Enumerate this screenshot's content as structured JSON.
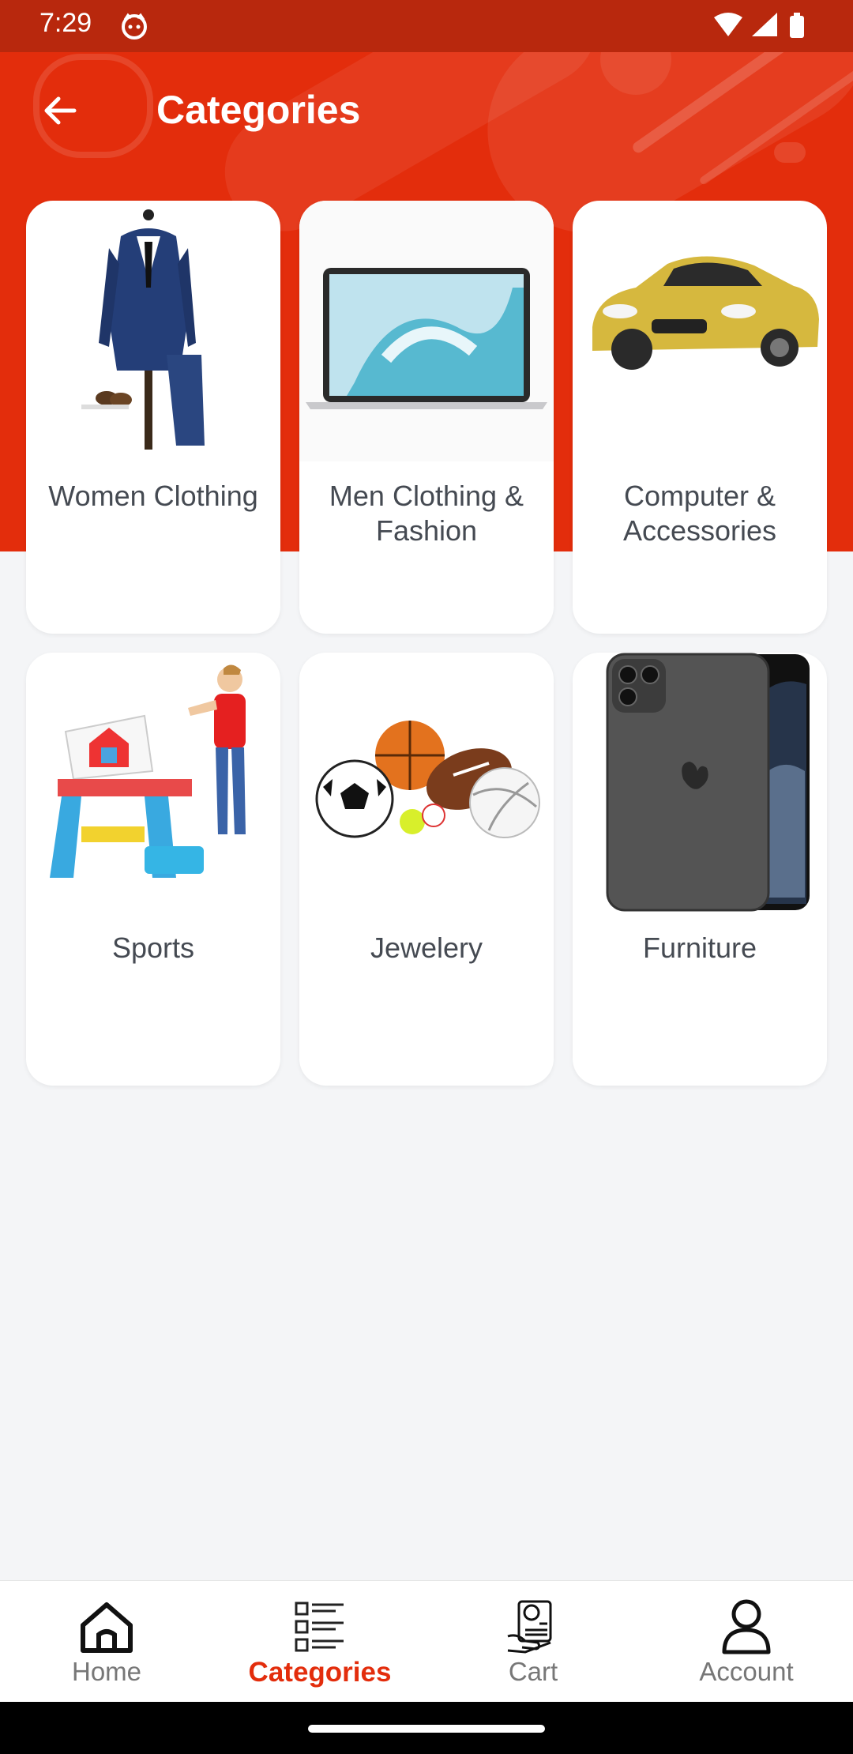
{
  "status_bar": {
    "time": "7:29"
  },
  "header": {
    "title": "Categories"
  },
  "categories": [
    {
      "label": "Women Clothing"
    },
    {
      "label": "Men Clothing & Fashion"
    },
    {
      "label": "Computer & Accessories"
    },
    {
      "label": "Sports"
    },
    {
      "label": "Jewelery"
    },
    {
      "label": "Furniture"
    }
  ],
  "bottom_nav": {
    "items": [
      {
        "label": "Home",
        "icon": "home-icon"
      },
      {
        "label": "Categories",
        "icon": "categories-icon",
        "active": true
      },
      {
        "label": "Cart",
        "icon": "cart-icon"
      },
      {
        "label": "Account",
        "icon": "account-icon"
      }
    ]
  },
  "colors": {
    "accent": "#e32d0c",
    "background": "#f4f5f7"
  }
}
